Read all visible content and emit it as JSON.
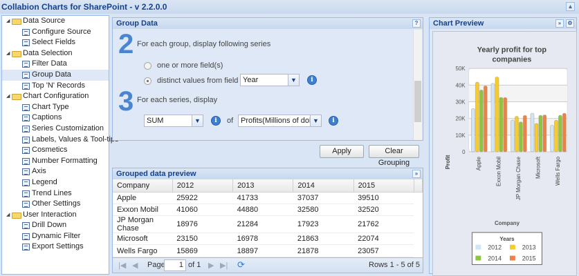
{
  "app": {
    "title": "Collabion Charts for SharePoint - v 2.2.0.0"
  },
  "sidebar": {
    "groups": [
      {
        "label": "Data Source",
        "items": [
          "Configure Source",
          "Select Fields"
        ]
      },
      {
        "label": "Data Selection",
        "items": [
          "Filter Data",
          "Group Data",
          "Top 'N' Records"
        ]
      },
      {
        "label": "Chart Configuration",
        "items": [
          "Chart Type",
          "Captions",
          "Series Customization",
          "Labels, Values & Tool-tips",
          "Cosmetics",
          "Number Formatting",
          "Axis",
          "Legend",
          "Trend Lines",
          "Other Settings"
        ]
      },
      {
        "label": "User Interaction",
        "items": [
          "Drill Down",
          "Dynamic Filter",
          "Export Settings"
        ]
      }
    ],
    "selected": "Group Data"
  },
  "group_panel": {
    "title": "Group Data",
    "step2_num": "2",
    "step2_text": "For each group, display following series",
    "opt1": "one or more field(s)",
    "opt2": "distinct values from field",
    "field_value": "Year",
    "step3_num": "3",
    "step3_text": "For each series, display",
    "agg_value": "SUM",
    "of_label": "of",
    "measure_value": "Profits(Millions of dollars)",
    "help": "?"
  },
  "buttons": {
    "apply": "Apply",
    "clear": "Clear Grouping"
  },
  "preview": {
    "title": "Grouped data preview",
    "columns": [
      "Company",
      "2012",
      "2013",
      "2014",
      "2015"
    ],
    "rows": [
      [
        "Apple",
        "25922",
        "41733",
        "37037",
        "39510"
      ],
      [
        "Exxon Mobil",
        "41060",
        "44880",
        "32580",
        "32520"
      ],
      [
        "JP Morgan Chase",
        "18976",
        "21284",
        "17923",
        "21762"
      ],
      [
        "Microsoft",
        "23150",
        "16978",
        "21863",
        "22074"
      ],
      [
        "Wells Fargo",
        "15869",
        "18897",
        "21878",
        "23057"
      ]
    ],
    "pager": {
      "page_label": "Page",
      "page": "1",
      "of": "of 1",
      "rows": "Rows 1 - 5 of 5"
    }
  },
  "chart_panel": {
    "title": "Chart Preview"
  },
  "chart_data": {
    "type": "bar",
    "title": "Yearly profit for top companies",
    "xlabel": "Company",
    "ylabel": "Profit",
    "ylim": [
      0,
      50000
    ],
    "yticks": [
      "0",
      "10K",
      "20K",
      "30K",
      "40K",
      "50K"
    ],
    "categories": [
      "Apple",
      "Exxon Mobil",
      "JP Morgan Chase",
      "Microsoft",
      "Wells Fargo"
    ],
    "legend_title": "Years",
    "legend_position": "bottom",
    "series": [
      {
        "name": "2012",
        "color": "#cfe6f8",
        "values": [
          25922,
          41060,
          18976,
          23150,
          15869
        ]
      },
      {
        "name": "2013",
        "color": "#f5cc2a",
        "values": [
          41733,
          44880,
          21284,
          16978,
          18897
        ]
      },
      {
        "name": "2014",
        "color": "#8cc63f",
        "values": [
          37037,
          32580,
          17923,
          21863,
          21878
        ]
      },
      {
        "name": "2015",
        "color": "#e9834a",
        "values": [
          39510,
          32520,
          21762,
          22074,
          23057
        ]
      }
    ]
  }
}
